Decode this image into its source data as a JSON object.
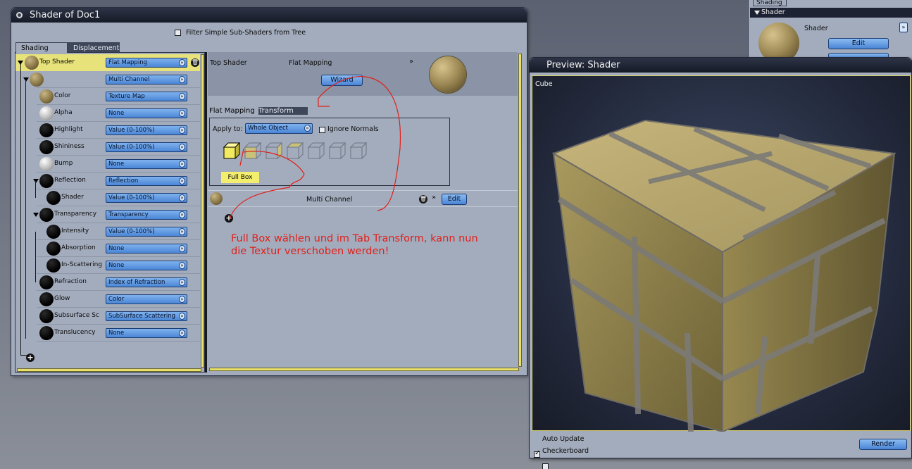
{
  "shader_window": {
    "title": "Shader of Doc1",
    "filter_label": "Filter Simple Sub-Shaders from Tree",
    "tabs": [
      "Shading",
      "Displacement"
    ],
    "tree": [
      {
        "label": "Top Shader",
        "value": "Flat Mapping",
        "selected": true
      },
      {
        "label": "",
        "value": "Multi Channel"
      },
      {
        "label": "Color",
        "value": "Texture Map"
      },
      {
        "label": "Alpha",
        "value": "None"
      },
      {
        "label": "Highlight",
        "value": "Value (0-100%)"
      },
      {
        "label": "Shininess",
        "value": "Value (0-100%)"
      },
      {
        "label": "Bump",
        "value": "None"
      },
      {
        "label": "Reflection",
        "value": "Reflection"
      },
      {
        "label": "Shader",
        "value": "Value (0-100%)"
      },
      {
        "label": "Transparency",
        "value": "Transparency"
      },
      {
        "label": "Intensity",
        "value": "Value (0-100%)"
      },
      {
        "label": "Absorption",
        "value": "None"
      },
      {
        "label": "In-Scattering",
        "value": "None"
      },
      {
        "label": "Refraction",
        "value": "Index of Refraction"
      },
      {
        "label": "Glow",
        "value": "Color"
      },
      {
        "label": "Subsurface Sc",
        "value": "SubSurface Scattering"
      },
      {
        "label": "Translucency",
        "value": "None"
      }
    ],
    "right": {
      "top_label": "Top Shader",
      "mapping_value": "Flat Mapping",
      "wizard_label": "Wizard",
      "sub_tabs": [
        "Flat Mapping",
        "Transform"
      ],
      "apply_to_label": "Apply to:",
      "apply_to_value": "Whole Object",
      "ignore_normals_label": "Ignore Normals",
      "fullbox_label": "Full Box",
      "multi_channel_label": "Multi Channel",
      "edit_label": "Edit"
    },
    "annotation_line1": "Full Box wählen und im Tab Transform, kann nun",
    "annotation_line2": "die Textur verschoben werden!"
  },
  "preview_window": {
    "title": "Preview: Shader",
    "object_label": "Cube",
    "auto_update_label": "Auto Update",
    "checkerboard_label": "Checkerboard",
    "render_label": "Render",
    "auto_update_checked": true
  },
  "back_panel": {
    "tab_label": "Shading",
    "section_label": "Shader",
    "shader_label": "Shader",
    "edit_label": "Edit"
  },
  "colors": {
    "panel": "#a3acbd",
    "titlebar": "#151a26",
    "accent_blue": "#4a84d4",
    "highlight_yellow": "#e7e27a",
    "annotation_red": "#e0201a"
  }
}
